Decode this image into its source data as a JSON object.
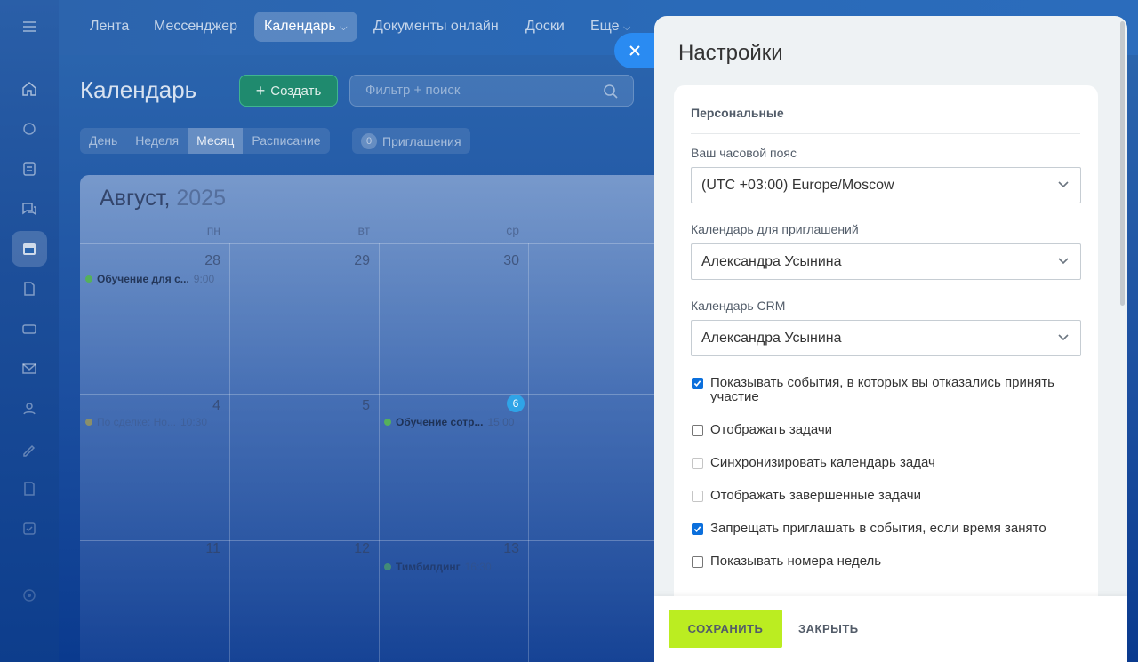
{
  "topnav": {
    "items": [
      "Лента",
      "Мессенджер",
      "Календарь",
      "Документы онлайн",
      "Доски",
      "Еще"
    ],
    "active": "Календарь"
  },
  "calendar": {
    "title": "Календарь",
    "create_label": "Создать",
    "search_placeholder": "Фильтр + поиск",
    "view_tabs": [
      "День",
      "Неделя",
      "Месяц",
      "Расписание"
    ],
    "active_view": "Месяц",
    "invites_count": "0",
    "invites_label": "Приглашения",
    "month_name": "Август,",
    "year": "2025",
    "weekdays": [
      "пн",
      "вт",
      "ср"
    ],
    "weeks": [
      {
        "days": [
          "28",
          "29",
          "30"
        ]
      },
      {
        "days": [
          "4",
          "5",
          "6"
        ]
      },
      {
        "days": [
          "11",
          "12",
          "13"
        ]
      }
    ],
    "today": "6",
    "events": [
      {
        "title": "Обучение для с...",
        "time": "9:00",
        "color": "#55b05b"
      },
      {
        "title": "По сделке: Но...",
        "time": "10:30",
        "color": "#8a8f6a"
      },
      {
        "title": "Обучение сотр...",
        "time": "15:00",
        "color": "#55b05b"
      },
      {
        "title": "Тимбилдинг",
        "time": "16:30",
        "color": "#55b05b"
      }
    ]
  },
  "settings": {
    "title": "Настройки",
    "section": "Персональные",
    "timezone_label": "Ваш часовой пояс",
    "timezone_value": "(UTC +03:00) Europe/Moscow",
    "invite_cal_label": "Календарь для приглашений",
    "invite_cal_value": "Александра Усынина",
    "crm_cal_label": "Календарь CRM",
    "crm_cal_value": "Александра Усынина",
    "options": [
      {
        "label": "Показывать события, в которых вы отказались принять участие",
        "checked": true,
        "disabled": false
      },
      {
        "label": "Отображать задачи",
        "checked": false,
        "disabled": false
      },
      {
        "label": "Синхронизировать календарь задач",
        "checked": false,
        "disabled": true
      },
      {
        "label": "Отображать завершенные задачи",
        "checked": false,
        "disabled": true
      },
      {
        "label": "Запрещать приглашать в события, если время занято",
        "checked": true,
        "disabled": false
      },
      {
        "label": "Показывать номера недель",
        "checked": false,
        "disabled": false
      }
    ],
    "save_label": "СОХРАНИТЬ",
    "close_label": "ЗАКРЫТЬ"
  },
  "colors": {
    "accent_blue": "#2a8bf2",
    "save_green": "#bbed21",
    "checkbox_blue": "#0b6fdc",
    "create_green": "#1f8a6e"
  }
}
